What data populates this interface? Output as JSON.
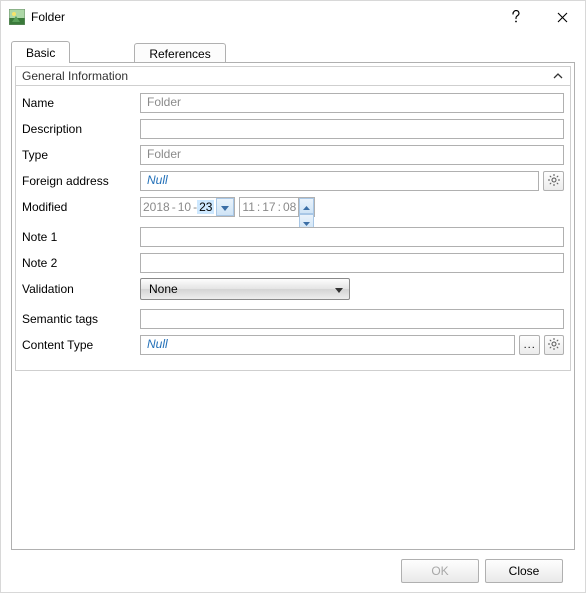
{
  "window": {
    "title": "Folder"
  },
  "tabs": {
    "basic": "Basic",
    "references": "References"
  },
  "group": {
    "title": "General Information"
  },
  "labels": {
    "name": "Name",
    "description": "Description",
    "type": "Type",
    "foreign_address": "Foreign address",
    "modified": "Modified",
    "note1": "Note 1",
    "note2": "Note 2",
    "validation": "Validation",
    "semantic_tags": "Semantic tags",
    "content_type": "Content Type"
  },
  "values": {
    "name": "Folder",
    "description": "",
    "type": "Folder",
    "foreign_address": "Null",
    "date": {
      "y": "2018",
      "m": "10",
      "d": "23"
    },
    "time": {
      "h": "11",
      "m": "17",
      "s": "08"
    },
    "note1": "",
    "note2": "",
    "validation": "None",
    "semantic_tags": "",
    "content_type": "Null",
    "ellipsis": "..."
  },
  "buttons": {
    "ok": "OK",
    "close": "Close"
  }
}
